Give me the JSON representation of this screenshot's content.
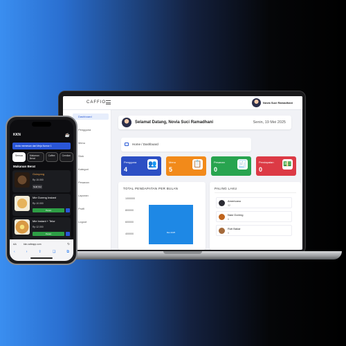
{
  "laptop": {
    "brand": "CAFFIO",
    "user_name": "Novia Suci Ramadhani",
    "sidebar": [
      "Dashboard",
      "Pengguna",
      "Menu",
      "Stok",
      "Kategori",
      "Pesanan",
      "Laporan",
      "Profil",
      "Logout"
    ],
    "welcome": "Selamat Datang, Novia Suci Ramadhani",
    "date": "Senin, 19 Mei 2025",
    "breadcrumb": "Home / Dashboard",
    "stats": [
      {
        "label": "Pengguna",
        "value": "4",
        "color": "#2c4fc4",
        "icon": "users-icon"
      },
      {
        "label": "Menu",
        "value": "5",
        "color": "#f28a1a",
        "icon": "menu-icon"
      },
      {
        "label": "Pesanan",
        "value": "0",
        "color": "#28a44f",
        "icon": "orders-icon"
      },
      {
        "label": "Pendapatan",
        "value": "0",
        "color": "#dc3a45",
        "icon": "money-icon"
      }
    ],
    "revenue_title": "TOTAL PENDAPATAN PER BULAN",
    "revenue_ticks": [
      "1000000",
      "800000",
      "600000",
      "400000"
    ],
    "revenue_bar_label": "Mei 2025",
    "best_title": "PALING LAKU",
    "best": [
      {
        "name": "Americano",
        "qty": "32"
      },
      {
        "name": "Nasi Goreng",
        "qty": "6"
      },
      {
        "name": "Roti Bakar",
        "qty": "9"
      }
    ]
  },
  "phone": {
    "title": "KKN",
    "banner": "Anda memesan dari Meja Nomor 1",
    "chips": [
      "Semua",
      "Makanan Berat",
      "Caffee",
      "Cemilan"
    ],
    "section": "Makanan Berat",
    "items": [
      {
        "name": "Gulayong",
        "price": "Rp 15.000",
        "button": "Sold Out",
        "food_color": "#3a2a1c"
      },
      {
        "name": "Mie Goreng Instant",
        "price": "Rp 10.000",
        "button": "Pesan",
        "food_color": "#d9a24a"
      },
      {
        "name": "Mie Instant + Telor",
        "price": "Rp 12.000",
        "button": "Pesan",
        "food_color": "#c9863a"
      }
    ],
    "url": "kkn.cafeapp.com",
    "aa": "AA"
  },
  "chart_data": {
    "type": "bar",
    "title": "TOTAL PENDAPATAN PER BULAN",
    "categories": [
      "Mei 2025"
    ],
    "values": [
      900000
    ],
    "ylim": [
      400000,
      1000000
    ]
  }
}
